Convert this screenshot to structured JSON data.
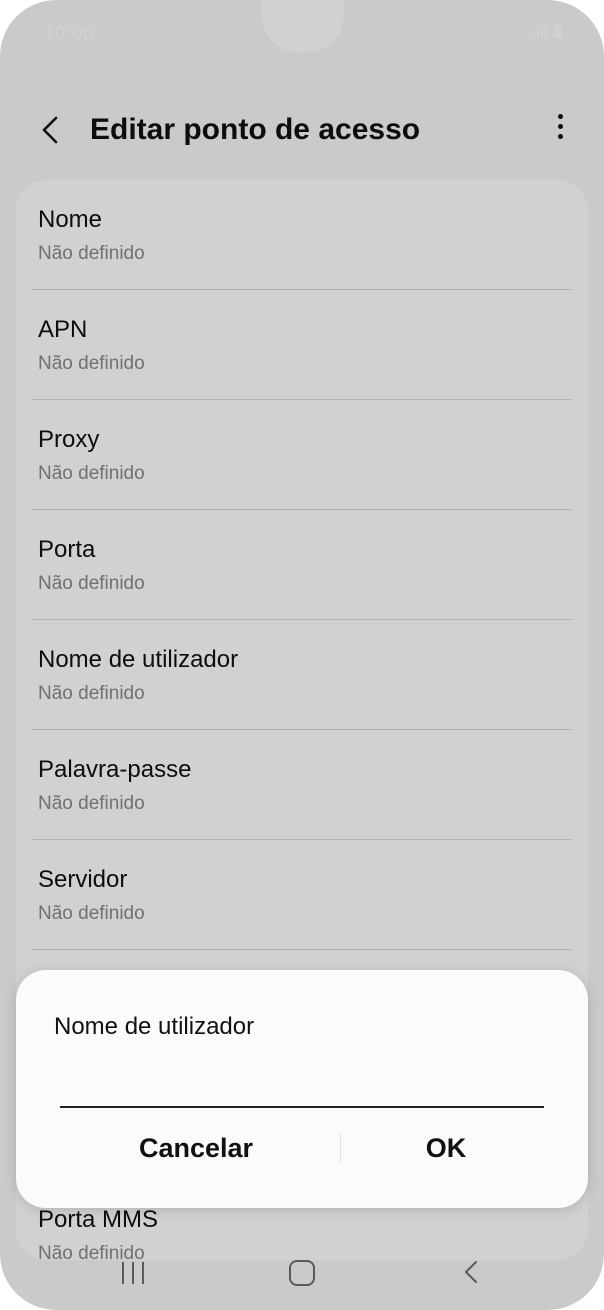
{
  "status_bar": {
    "time": "10:00"
  },
  "header": {
    "title": "Editar ponto de acesso"
  },
  "settings": [
    {
      "label": "Nome",
      "value": "Não definido"
    },
    {
      "label": "APN",
      "value": "Não definido"
    },
    {
      "label": "Proxy",
      "value": "Não definido"
    },
    {
      "label": "Porta",
      "value": "Não definido"
    },
    {
      "label": "Nome de utilizador",
      "value": "Não definido"
    },
    {
      "label": "Palavra-passe",
      "value": "Não definido"
    },
    {
      "label": "Servidor",
      "value": "Não definido"
    },
    {
      "label": "Porta MMS",
      "value": "Não definido"
    }
  ],
  "dialog": {
    "title": "Nome de utilizador",
    "input_value": "",
    "cancel_label": "Cancelar",
    "ok_label": "OK"
  }
}
